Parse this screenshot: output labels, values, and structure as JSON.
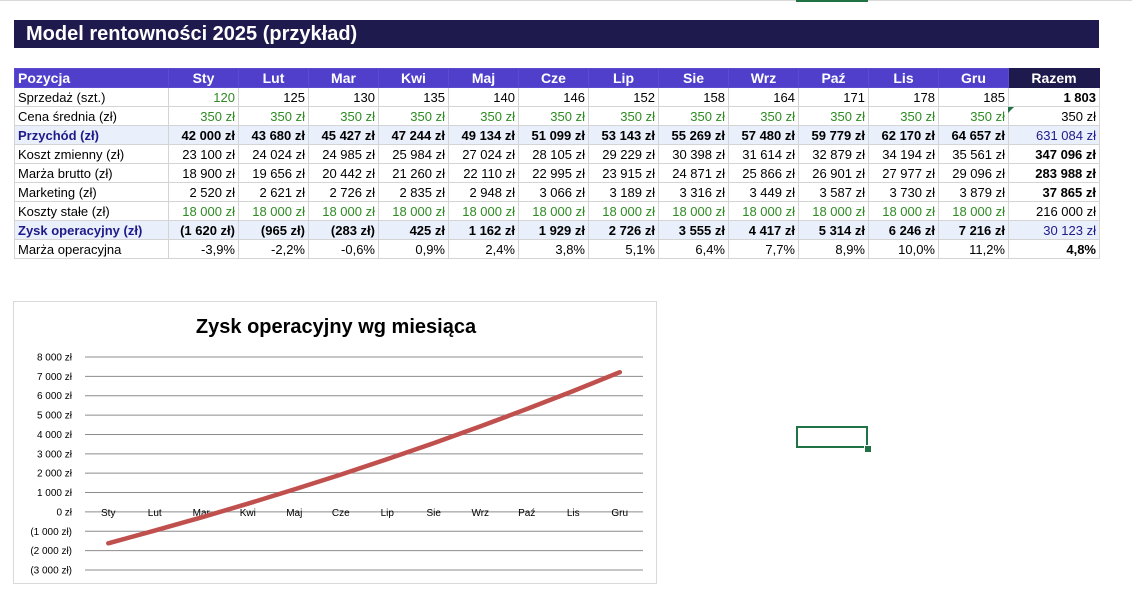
{
  "title": "Model rentowności 2025 (przykład)",
  "table": {
    "header_label": "Pozycja",
    "months": [
      "Sty",
      "Lut",
      "Mar",
      "Kwi",
      "Maj",
      "Cze",
      "Lip",
      "Sie",
      "Wrz",
      "Paź",
      "Lis",
      "Gru"
    ],
    "total_label": "Razem",
    "rows": [
      {
        "label": "Sprzedaż (szt.)",
        "values": [
          "120",
          "125",
          "130",
          "135",
          "140",
          "146",
          "152",
          "158",
          "164",
          "171",
          "178",
          "185"
        ],
        "total": "1 803"
      },
      {
        "label": "Cena średnia (zł)",
        "values": [
          "350 zł",
          "350 zł",
          "350 zł",
          "350 zł",
          "350 zł",
          "350 zł",
          "350 zł",
          "350 zł",
          "350 zł",
          "350 zł",
          "350 zł",
          "350 zł"
        ],
        "total": "350 zł"
      },
      {
        "label": "Przychód (zł)",
        "values": [
          "42 000 zł",
          "43 680 zł",
          "45 427 zł",
          "47 244 zł",
          "49 134 zł",
          "51 099 zł",
          "53 143 zł",
          "55 269 zł",
          "57 480 zł",
          "59 779 zł",
          "62 170 zł",
          "64 657 zł"
        ],
        "total": "631 084 zł"
      },
      {
        "label": "Koszt zmienny (zł)",
        "values": [
          "23 100 zł",
          "24 024 zł",
          "24 985 zł",
          "25 984 zł",
          "27 024 zł",
          "28 105 zł",
          "29 229 zł",
          "30 398 zł",
          "31 614 zł",
          "32 879 zł",
          "34 194 zł",
          "35 561 zł"
        ],
        "total": "347 096 zł"
      },
      {
        "label": "Marża brutto (zł)",
        "values": [
          "18 900 zł",
          "19 656 zł",
          "20 442 zł",
          "21 260 zł",
          "22 110 zł",
          "22 995 zł",
          "23 915 zł",
          "24 871 zł",
          "25 866 zł",
          "26 901 zł",
          "27 977 zł",
          "29 096 zł"
        ],
        "total": "283 988 zł"
      },
      {
        "label": "Marketing (zł)",
        "values": [
          "2 520 zł",
          "2 621 zł",
          "2 726 zł",
          "2 835 zł",
          "2 948 zł",
          "3 066 zł",
          "3 189 zł",
          "3 316 zł",
          "3 449 zł",
          "3 587 zł",
          "3 730 zł",
          "3 879 zł"
        ],
        "total": "37 865 zł"
      },
      {
        "label": "Koszty stałe (zł)",
        "values": [
          "18 000 zł",
          "18 000 zł",
          "18 000 zł",
          "18 000 zł",
          "18 000 zł",
          "18 000 zł",
          "18 000 zł",
          "18 000 zł",
          "18 000 zł",
          "18 000 zł",
          "18 000 zł",
          "18 000 zł"
        ],
        "total": "216 000 zł"
      },
      {
        "label": "Zysk operacyjny (zł)",
        "values": [
          "(1 620 zł)",
          "(965 zł)",
          "(283 zł)",
          "425 zł",
          "1 162 zł",
          "1 929 zł",
          "2 726 zł",
          "3 555 zł",
          "4 417 zł",
          "5 314 zł",
          "6 246 zł",
          "7 216 zł"
        ],
        "total": "30 123 zł"
      },
      {
        "label": "Marża operacyjna",
        "values": [
          "-3,9%",
          "-2,2%",
          "-0,6%",
          "0,9%",
          "2,4%",
          "3,8%",
          "5,1%",
          "6,4%",
          "7,7%",
          "8,9%",
          "10,0%",
          "11,2%"
        ],
        "total": "4,8%"
      }
    ]
  },
  "chart_data": {
    "type": "line",
    "title": "Zysk operacyjny wg miesiąca",
    "categories": [
      "Sty",
      "Lut",
      "Mar",
      "Kwi",
      "Maj",
      "Cze",
      "Lip",
      "Sie",
      "Wrz",
      "Paź",
      "Lis",
      "Gru"
    ],
    "series": [
      {
        "values": [
          -1620,
          -965,
          -283,
          425,
          1162,
          1929,
          2726,
          3555,
          4417,
          5314,
          6246,
          7216
        ],
        "color": "#c0504d"
      }
    ],
    "ylim": [
      -3000,
      8000
    ],
    "yticks": [
      8000,
      7000,
      6000,
      5000,
      4000,
      3000,
      2000,
      1000,
      0,
      -1000,
      -2000,
      -3000
    ],
    "ytick_labels": [
      "8 000 zł",
      "7 000 zł",
      "6 000 zł",
      "5 000 zł",
      "4 000 zł",
      "3 000 zł",
      "2 000 zł",
      "1 000 zł",
      "0 zł",
      "(1 000 zł)",
      "(2 000 zł)",
      "(3 000 zł)"
    ],
    "grid": true,
    "xlabel": "",
    "ylabel": ""
  },
  "colors": {
    "header_bg": "#4f3fca",
    "title_bg": "#1f1a4d",
    "input_green": "#2e8b22",
    "highlight_row": "#eaf0fb",
    "line": "#c0504d",
    "selection": "#217346"
  }
}
